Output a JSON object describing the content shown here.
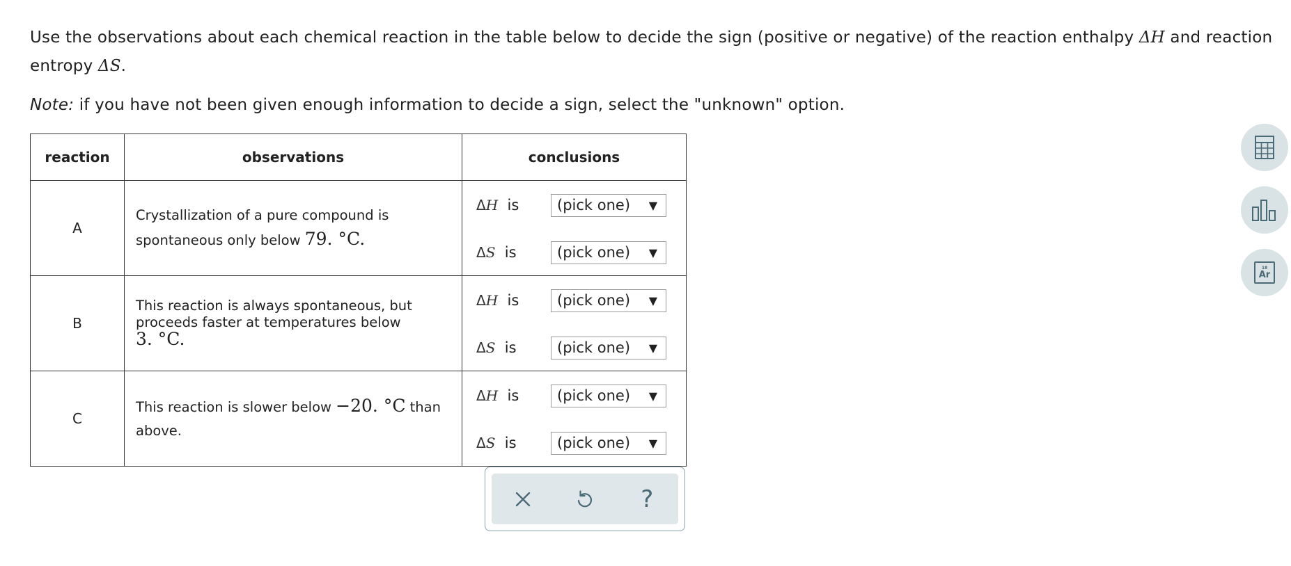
{
  "prompt": {
    "line1_pre": "Use the observations about each chemical reaction in the table below to decide the sign (positive or negative) of the reaction enthalpy ",
    "enthalpy_symbol": "ΔH",
    "line1_post": " and reaction",
    "line2_pre": "entropy ",
    "entropy_symbol": "ΔS",
    "line2_post": "."
  },
  "note": {
    "label": "Note:",
    "text": " if you have not been given enough information to decide a sign, select the \"unknown\" option."
  },
  "table": {
    "headers": {
      "reaction": "reaction",
      "observations": "observations",
      "conclusions": "conclusions"
    },
    "rows": [
      {
        "reaction": "A",
        "obs_pre": "Crystallization of a pure compound is spontaneous only below ",
        "obs_value": "79. °C",
        "obs_post": ".",
        "dH_delta": "Δ",
        "dH_var": "H",
        "dH_is": "is",
        "dH_select": "(pick one)",
        "dS_delta": "Δ",
        "dS_var": "S",
        "dS_is": "is",
        "dS_select": "(pick one)"
      },
      {
        "reaction": "B",
        "obs_pre": "This reaction is always spontaneous, but proceeds faster at temperatures below",
        "obs_value": "3. °C",
        "obs_post": ".",
        "dH_delta": "Δ",
        "dH_var": "H",
        "dH_is": "is",
        "dH_select": "(pick one)",
        "dS_delta": "Δ",
        "dS_var": "S",
        "dS_is": "is",
        "dS_select": "(pick one)"
      },
      {
        "reaction": "C",
        "obs_pre": "This reaction is slower below ",
        "obs_value": "−20. °C",
        "obs_post": " than above.",
        "dH_delta": "Δ",
        "dH_var": "H",
        "dH_is": "is",
        "dH_select": "(pick one)",
        "dS_delta": "Δ",
        "dS_var": "S",
        "dS_is": "is",
        "dS_select": "(pick one)"
      }
    ],
    "dropdown_arrow": "▼"
  },
  "actions": {
    "clear_icon": "close-icon",
    "undo_icon": "undo-icon",
    "help_label": "?"
  },
  "side_tools": {
    "calculator_icon": "calculator-icon",
    "data_icon": "bar-chart-icon",
    "periodic_table_number": "18",
    "periodic_table_symbol": "Ar"
  },
  "colors": {
    "tool_bg": "#d9e2e5",
    "icon_stroke": "#4b6a77",
    "actionbar_bg": "#dfe7ea"
  }
}
